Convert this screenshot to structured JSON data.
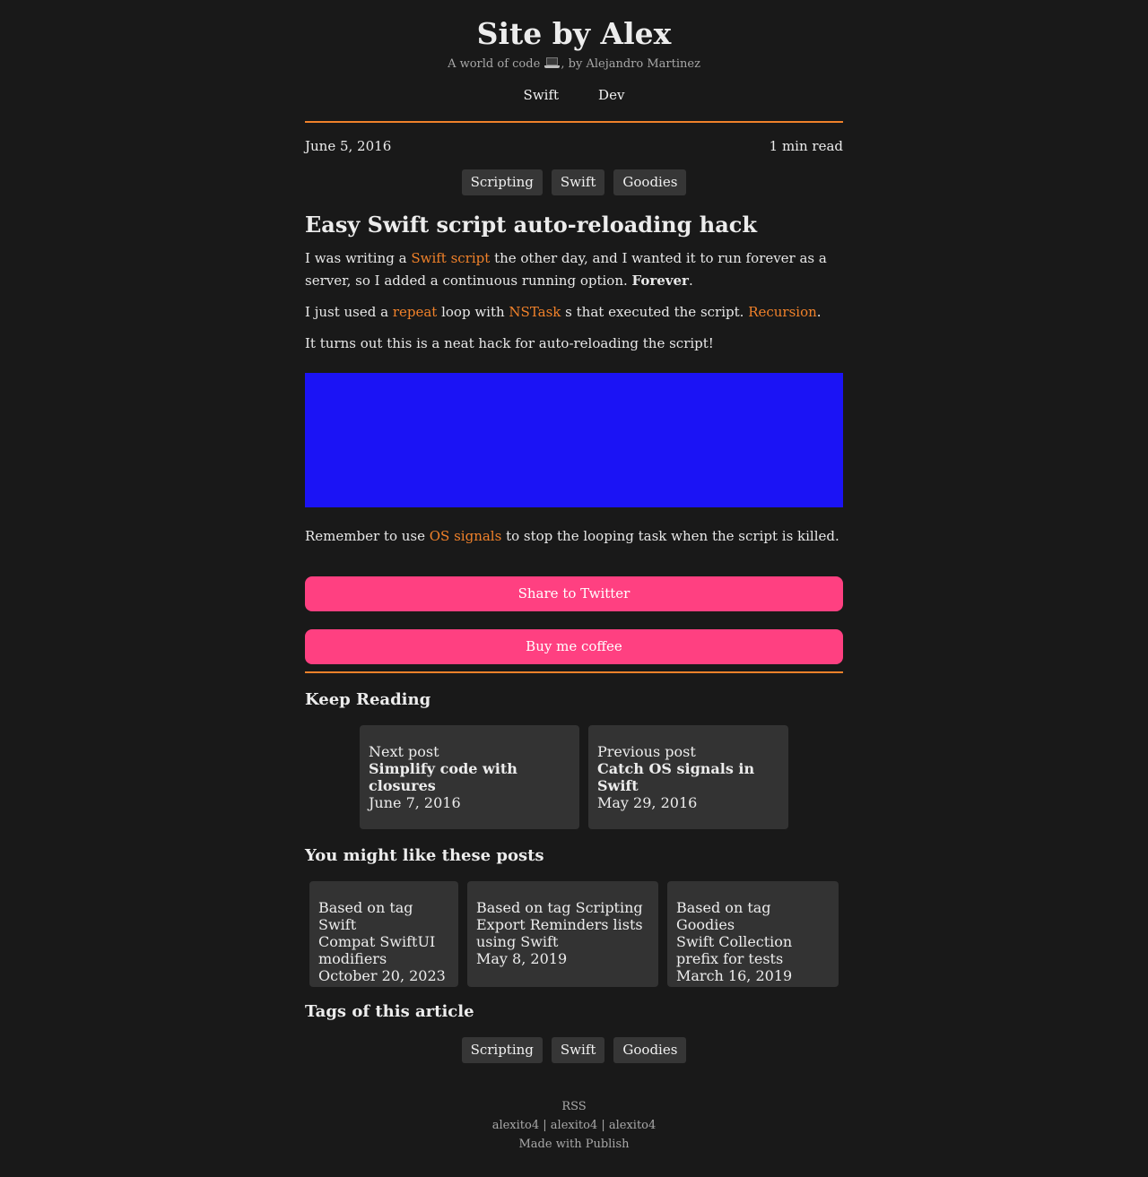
{
  "site": {
    "title": "Site by Alex",
    "subtitle_before": "A world of code",
    "subtitle_after": ", by Alejandro Martinez",
    "laptop_icon": "laptop-icon"
  },
  "nav": [
    "Swift",
    "Dev"
  ],
  "post": {
    "date": "June 5, 2016",
    "read_time": "1 min read",
    "tags": [
      "Scripting",
      "Swift",
      "Goodies"
    ],
    "title": "Easy Swift script auto-reloading hack",
    "p1": {
      "a": "I was writing a ",
      "link": "Swift script",
      "b": " the other day, and I wanted it to run forever as a server, so I added a continuous running option. ",
      "strong": "Forever",
      "c": "."
    },
    "p2": {
      "a": "I just used a ",
      "link1": "repeat",
      "b": " loop with ",
      "link2": "NSTask",
      "c": " s that executed the script. ",
      "link3": "Recursion",
      "d": "."
    },
    "p3": "It turns out this is a neat hack for auto-reloading the script!",
    "media_color": "#1b13f5",
    "p4": {
      "a": "Remember to use ",
      "link": "OS signals",
      "b": " to stop the looping task when the script is killed."
    }
  },
  "actions": {
    "share": "Share to Twitter",
    "coffee": "Buy me coffee",
    "accent": "#ff4081"
  },
  "keep_reading": {
    "title": "Keep Reading",
    "next": {
      "label": "Next post",
      "title": "Simplify code with closures",
      "date": "June 7, 2016"
    },
    "previous": {
      "label": "Previous post",
      "title": "Catch OS signals in Swift",
      "date": "May 29, 2016"
    }
  },
  "you_might_like": {
    "title": "You might like these posts",
    "items": [
      {
        "label": "Based on tag Swift",
        "title": "Compat SwiftUI modifiers",
        "date": "October 20, 2023"
      },
      {
        "label": "Based on tag Scripting",
        "title": "Export Reminders lists using Swift",
        "date": "May 8, 2019"
      },
      {
        "label": "Based on tag Goodies",
        "title": "Swift Collection prefix for tests",
        "date": "March 16, 2019"
      }
    ]
  },
  "article_tags": {
    "title": "Tags of this article",
    "tags": [
      "Scripting",
      "Swift",
      "Goodies"
    ]
  },
  "footer": {
    "rss": "RSS",
    "social": [
      "alexito4",
      "alexito4",
      "alexito4"
    ],
    "separator": " | ",
    "made_with": "Made with Publish"
  },
  "colors": {
    "background": "#191919",
    "link": "#f0812a",
    "rule": "#f0812a",
    "card": "#333333"
  }
}
